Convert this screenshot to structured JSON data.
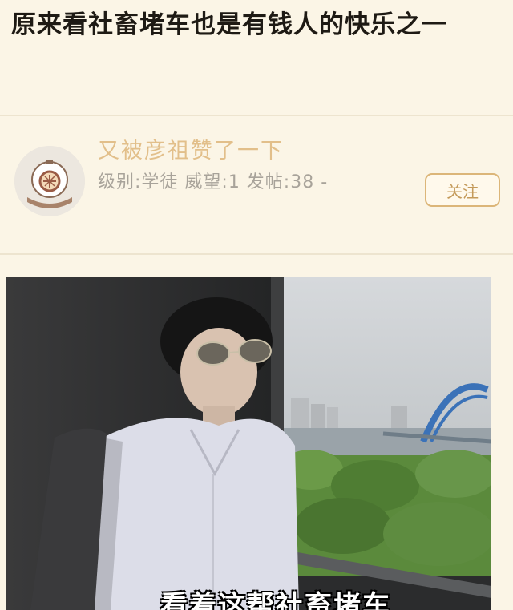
{
  "post": {
    "title": "原来看社畜堵车也是有钱人的快乐之一"
  },
  "author": {
    "name": "又被彦祖赞了一下",
    "meta": "级别:学徒 威望:1 发帖:38 -",
    "follow_label": "关注",
    "avatar_icon": "diving-helmet-icon"
  },
  "image": {
    "caption": "看着这帮社畜堵车"
  },
  "colors": {
    "background": "#fbf5e6",
    "username": "#e2bf8a",
    "meta_text": "#a8a39a",
    "follow_border": "#dcb679",
    "follow_text": "#c49a5a"
  }
}
